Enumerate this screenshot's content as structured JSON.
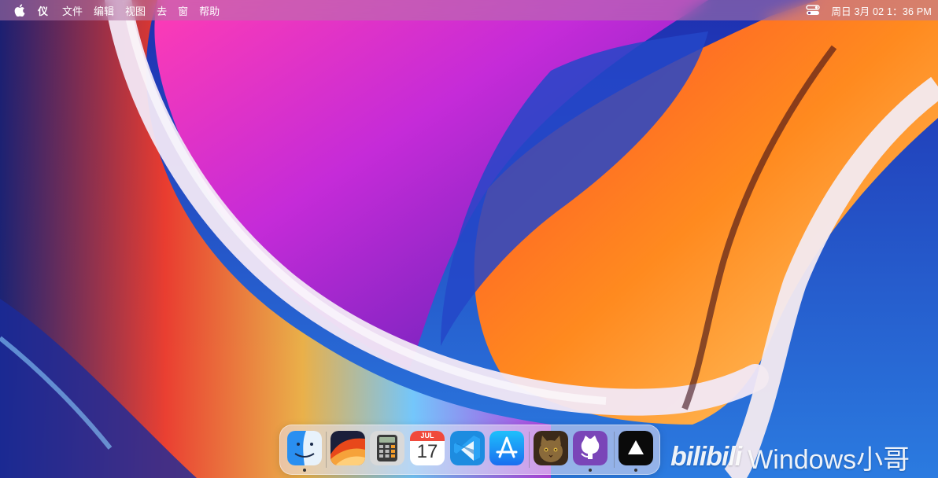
{
  "menubar": {
    "app_name": "仪",
    "menus": [
      "文件",
      "编辑",
      "视图",
      "去",
      "窗",
      "帮助"
    ],
    "clock": "周日 3月 02 1：36 PM"
  },
  "dock": {
    "apps": [
      {
        "name": "Finder",
        "icon": "finder-icon",
        "running": true
      },
      {
        "name": "macOS Ventura",
        "icon": "ventura-icon",
        "running": false
      },
      {
        "name": "Calculator",
        "icon": "calculator-icon",
        "running": false
      },
      {
        "name": "Calendar",
        "icon": "calendar-icon",
        "running": false,
        "month": "JUL",
        "day": "17"
      },
      {
        "name": "Visual Studio Code",
        "icon": "vscode-icon",
        "running": false
      },
      {
        "name": "App Store",
        "icon": "app-store-icon",
        "running": false
      },
      {
        "name": "Photo",
        "icon": "cat-photo-icon",
        "running": false
      },
      {
        "name": "GitHub",
        "icon": "github-icon",
        "running": true
      },
      {
        "name": "Vercel",
        "icon": "vercel-icon",
        "running": true
      }
    ]
  },
  "watermark": {
    "logo": "bilibili",
    "text": "Windows小哥"
  }
}
